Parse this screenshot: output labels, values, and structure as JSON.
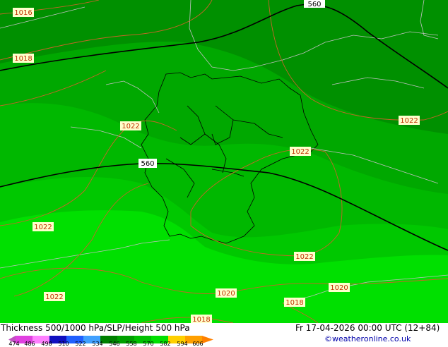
{
  "title": "Thickness 500/1000 hPa/SLP/Height 500 hPa",
  "valid_time": "Fr 17-04-2026 00:00 UTC (12+84)",
  "credit": "©weatheronline.co.uk",
  "legend": {
    "ticks": [
      "474",
      "486",
      "498",
      "510",
      "522",
      "534",
      "546",
      "558",
      "570",
      "582",
      "594",
      "606"
    ],
    "colors": [
      "#c050c0",
      "#e040e0",
      "#ff80ff",
      "#1010c0",
      "#2060ff",
      "#40a0ff",
      "#60d0ff",
      "#008000",
      "#00a000",
      "#00c000",
      "#00e000",
      "#ffa000"
    ]
  },
  "contour_labels": {
    "slp": [
      "1016",
      "1018",
      "1022",
      "1022",
      "1022",
      "1022",
      "1022",
      "1022",
      "1022",
      "1020",
      "1020",
      "1018",
      "1018"
    ],
    "height": [
      "560",
      "560"
    ]
  },
  "colors": {
    "thick_546": "#009000",
    "thick_552": "#00a800",
    "thick_558": "#00c000",
    "thick_564": "#00d800",
    "thick_570": "#00e800",
    "isobar": "#c86428",
    "height_line": "#000000",
    "border": "#000000",
    "coast": "#c0c0c0"
  }
}
